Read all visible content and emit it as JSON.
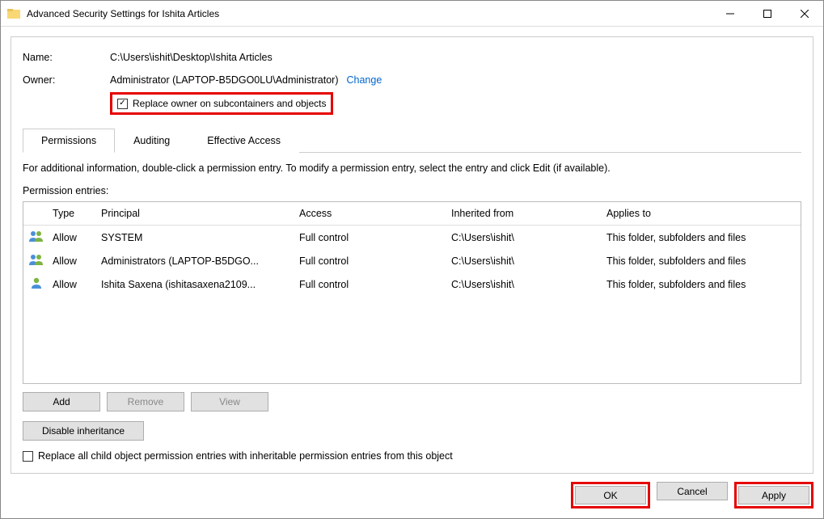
{
  "titlebar": {
    "title": "Advanced Security Settings for Ishita Articles"
  },
  "info": {
    "name_label": "Name:",
    "name_value": "C:\\Users\\ishit\\Desktop\\Ishita Articles",
    "owner_label": "Owner:",
    "owner_value": "Administrator (LAPTOP-B5DGO0LU\\Administrator)",
    "change_link": "Change",
    "replace_owner_label": "Replace owner on subcontainers and objects"
  },
  "tabs": {
    "permissions": "Permissions",
    "auditing": "Auditing",
    "effective": "Effective Access"
  },
  "main": {
    "info_text": "For additional information, double-click a permission entry. To modify a permission entry, select the entry and click Edit (if available).",
    "entries_label": "Permission entries:",
    "columns": {
      "type": "Type",
      "principal": "Principal",
      "access": "Access",
      "inherited": "Inherited from",
      "applies": "Applies to"
    },
    "rows": [
      {
        "type": "Allow",
        "principal": "SYSTEM",
        "access": "Full control",
        "inherited": "C:\\Users\\ishit\\",
        "applies": "This folder, subfolders and files",
        "icon": "users"
      },
      {
        "type": "Allow",
        "principal": "Administrators (LAPTOP-B5DGO...",
        "access": "Full control",
        "inherited": "C:\\Users\\ishit\\",
        "applies": "This folder, subfolders and files",
        "icon": "users"
      },
      {
        "type": "Allow",
        "principal": "Ishita Saxena (ishitasaxena2109...",
        "access": "Full control",
        "inherited": "C:\\Users\\ishit\\",
        "applies": "This folder, subfolders and files",
        "icon": "user"
      }
    ],
    "buttons": {
      "add": "Add",
      "remove": "Remove",
      "view": "View",
      "disable_inherit": "Disable inheritance"
    },
    "replace_child_label": "Replace all child object permission entries with inheritable permission entries from this object"
  },
  "footer": {
    "ok": "OK",
    "cancel": "Cancel",
    "apply": "Apply"
  }
}
